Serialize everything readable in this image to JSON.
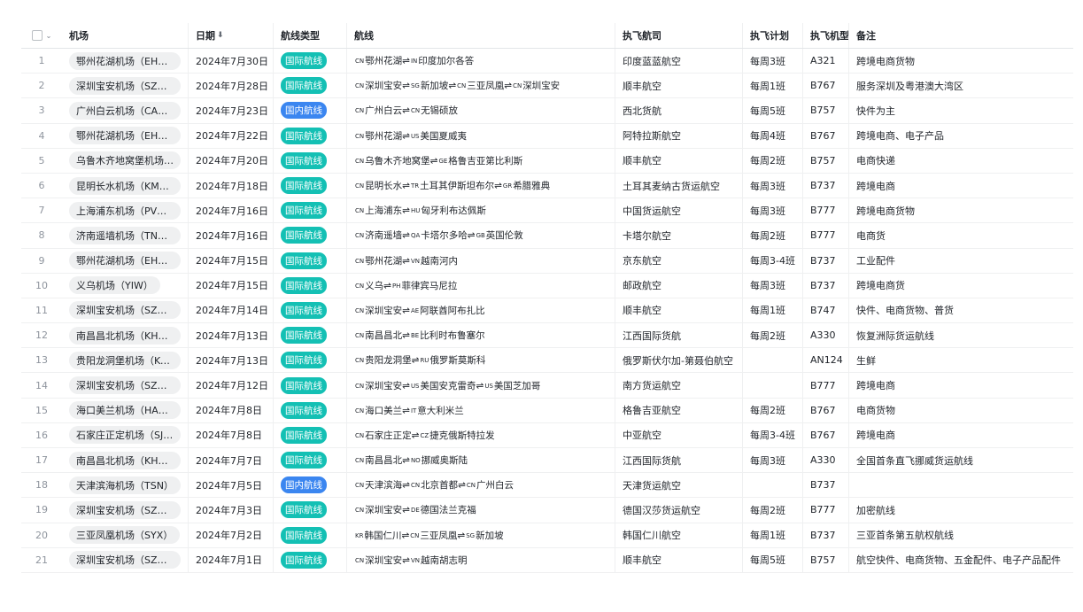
{
  "colors": {
    "intl_badge": "#14c0b4",
    "dom_badge": "#3b86f0"
  },
  "header": {
    "airport": "机场",
    "date": "日期",
    "route_type": "航线类型",
    "route": "航线",
    "airline": "执飞航司",
    "plan": "执飞计划",
    "aircraft": "执飞机型",
    "note": "备注"
  },
  "rows": [
    {
      "n": "1",
      "airport": "鄂州花湖机场（EHU）",
      "date": "2024年7月30日",
      "type": "国际航线",
      "route": [
        [
          "CN",
          "鄂州花湖"
        ],
        [
          "IN",
          "印度加尔各答"
        ]
      ],
      "airline": "印度蓝蓝航空",
      "plan": "每周3班",
      "ac": "A321",
      "note": "跨境电商货物"
    },
    {
      "n": "2",
      "airport": "深圳宝安机场（SZX）",
      "date": "2024年7月28日",
      "type": "国际航线",
      "route": [
        [
          "CN",
          "深圳宝安"
        ],
        [
          "SG",
          "新加坡"
        ],
        [
          "CN",
          "三亚凤凰"
        ],
        [
          "CN",
          "深圳宝安"
        ]
      ],
      "airline": "顺丰航空",
      "plan": "每周1班",
      "ac": "B767",
      "note": "服务深圳及粤港澳大湾区"
    },
    {
      "n": "3",
      "airport": "广州白云机场（CAN）",
      "date": "2024年7月23日",
      "type": "国内航线",
      "route": [
        [
          "CN",
          "广州白云"
        ],
        [
          "CN",
          "无锡硕放"
        ]
      ],
      "airline": "西北货航",
      "plan": "每周5班",
      "ac": "B757",
      "note": "快件为主"
    },
    {
      "n": "4",
      "airport": "鄂州花湖机场（EHU）",
      "date": "2024年7月22日",
      "type": "国际航线",
      "route": [
        [
          "CN",
          "鄂州花湖"
        ],
        [
          "US",
          "美国夏威夷"
        ]
      ],
      "airline": "阿特拉斯航空",
      "plan": "每周4班",
      "ac": "B767",
      "note": "跨境电商、电子产品"
    },
    {
      "n": "5",
      "airport": "乌鲁木齐地窝堡机场（...",
      "date": "2024年7月20日",
      "type": "国际航线",
      "route": [
        [
          "CN",
          "乌鲁木齐地窝堡"
        ],
        [
          "GE",
          "格鲁吉亚第比利斯"
        ]
      ],
      "airline": "顺丰航空",
      "plan": "每周2班",
      "ac": "B757",
      "note": "电商快递"
    },
    {
      "n": "6",
      "airport": "昆明长水机场（KMG）",
      "date": "2024年7月18日",
      "type": "国际航线",
      "route": [
        [
          "CN",
          "昆明长水"
        ],
        [
          "TR",
          "土耳其伊斯坦布尔"
        ],
        [
          "GR",
          "希腊雅典"
        ]
      ],
      "airline": "土耳其麦纳古货运航空",
      "plan": "每周3班",
      "ac": "B737",
      "note": "跨境电商"
    },
    {
      "n": "7",
      "airport": "上海浦东机场（PVG）",
      "date": "2024年7月16日",
      "type": "国际航线",
      "route": [
        [
          "CN",
          "上海浦东"
        ],
        [
          "HU",
          "匈牙利布达佩斯"
        ]
      ],
      "airline": "中国货运航空",
      "plan": "每周3班",
      "ac": "B777",
      "note": "跨境电商货物"
    },
    {
      "n": "8",
      "airport": "济南遥墙机场（TNA）",
      "date": "2024年7月16日",
      "type": "国际航线",
      "route": [
        [
          "CN",
          "济南遥墙"
        ],
        [
          "QA",
          "卡塔尔多哈"
        ],
        [
          "GB",
          "英国伦敦"
        ]
      ],
      "airline": "卡塔尔航空",
      "plan": "每周2班",
      "ac": "B777",
      "note": "电商货"
    },
    {
      "n": "9",
      "airport": "鄂州花湖机场（EHU）",
      "date": "2024年7月15日",
      "type": "国际航线",
      "route": [
        [
          "CN",
          "鄂州花湖"
        ],
        [
          "VN",
          "越南河内"
        ]
      ],
      "airline": "京东航空",
      "plan": "每周3-4班",
      "ac": "B737",
      "note": "工业配件"
    },
    {
      "n": "10",
      "airport": "义乌机场（YIW）",
      "date": "2024年7月15日",
      "type": "国际航线",
      "route": [
        [
          "CN",
          "义乌"
        ],
        [
          "PH",
          "菲律宾马尼拉"
        ]
      ],
      "airline": "邮政航空",
      "plan": "每周3班",
      "ac": "B737",
      "note": "跨境电商货"
    },
    {
      "n": "11",
      "airport": "深圳宝安机场（SZX）",
      "date": "2024年7月14日",
      "type": "国际航线",
      "route": [
        [
          "CN",
          "深圳宝安"
        ],
        [
          "AE",
          "阿联酋阿布扎比"
        ]
      ],
      "airline": "顺丰航空",
      "plan": "每周1班",
      "ac": "B747",
      "note": "快件、电商货物、普货"
    },
    {
      "n": "12",
      "airport": "南昌昌北机场（KHN）",
      "date": "2024年7月13日",
      "type": "国际航线",
      "route": [
        [
          "CN",
          "南昌昌北"
        ],
        [
          "BE",
          "比利时布鲁塞尔"
        ]
      ],
      "airline": "江西国际货航",
      "plan": "每周2班",
      "ac": "A330",
      "note": "恢复洲际货运航线"
    },
    {
      "n": "13",
      "airport": "贵阳龙洞堡机场（KW...",
      "date": "2024年7月13日",
      "type": "国际航线",
      "route": [
        [
          "CN",
          "贵阳龙洞堡"
        ],
        [
          "RU",
          "俄罗斯莫斯科"
        ]
      ],
      "airline": "俄罗斯伏尔加-第聂伯航空",
      "plan": "",
      "ac": "AN124",
      "note": "生鲜"
    },
    {
      "n": "14",
      "airport": "深圳宝安机场（SZX）",
      "date": "2024年7月12日",
      "type": "国际航线",
      "route": [
        [
          "CN",
          "深圳宝安"
        ],
        [
          "US",
          "美国安克雷奇"
        ],
        [
          "US",
          "美国芝加哥"
        ]
      ],
      "airline": "南方货运航空",
      "plan": "",
      "ac": "B777",
      "note": "跨境电商"
    },
    {
      "n": "15",
      "airport": "海口美兰机场（HAK）",
      "date": "2024年7月8日",
      "type": "国际航线",
      "route": [
        [
          "CN",
          "海口美兰"
        ],
        [
          "IT",
          "意大利米兰"
        ]
      ],
      "airline": "格鲁吉亚航空",
      "plan": "每周2班",
      "ac": "B767",
      "note": "电商货物"
    },
    {
      "n": "16",
      "airport": "石家庄正定机场（SJW）",
      "date": "2024年7月8日",
      "type": "国际航线",
      "route": [
        [
          "CN",
          "石家庄正定"
        ],
        [
          "CZ",
          "捷克俄斯特拉发"
        ]
      ],
      "airline": "中亚航空",
      "plan": "每周3-4班",
      "ac": "B767",
      "note": "跨境电商"
    },
    {
      "n": "17",
      "airport": "南昌昌北机场（KHN）",
      "date": "2024年7月7日",
      "type": "国际航线",
      "route": [
        [
          "CN",
          "南昌昌北"
        ],
        [
          "NO",
          "挪威奥斯陆"
        ]
      ],
      "airline": "江西国际货航",
      "plan": "每周3班",
      "ac": "A330",
      "note": "全国首条直飞挪威货运航线"
    },
    {
      "n": "18",
      "airport": "天津滨海机场（TSN）",
      "date": "2024年7月5日",
      "type": "国内航线",
      "route": [
        [
          "CN",
          "天津滨海"
        ],
        [
          "CN",
          "北京首都"
        ],
        [
          "CN",
          "广州白云"
        ]
      ],
      "airline": "天津货运航空",
      "plan": "",
      "ac": "B737",
      "note": ""
    },
    {
      "n": "19",
      "airport": "深圳宝安机场（SZX）",
      "date": "2024年7月3日",
      "type": "国际航线",
      "route": [
        [
          "CN",
          "深圳宝安"
        ],
        [
          "DE",
          "德国法兰克福"
        ]
      ],
      "airline": "德国汉莎货运航空",
      "plan": "每周2班",
      "ac": "B777",
      "note": "加密航线"
    },
    {
      "n": "20",
      "airport": "三亚凤凰机场（SYX）",
      "date": "2024年7月2日",
      "type": "国际航线",
      "route": [
        [
          "KR",
          "韩国仁川"
        ],
        [
          "CN",
          "三亚凤凰"
        ],
        [
          "SG",
          "新加坡"
        ]
      ],
      "airline": "韩国仁川航空",
      "plan": "每周1班",
      "ac": "B737",
      "note": "三亚首条第五航权航线"
    },
    {
      "n": "21",
      "airport": "深圳宝安机场（SZX）",
      "date": "2024年7月1日",
      "type": "国际航线",
      "route": [
        [
          "CN",
          "深圳宝安"
        ],
        [
          "VN",
          "越南胡志明"
        ]
      ],
      "airline": "顺丰航空",
      "plan": "每周5班",
      "ac": "B757",
      "note": "航空快件、电商货物、五金配件、电子产品配件"
    }
  ]
}
